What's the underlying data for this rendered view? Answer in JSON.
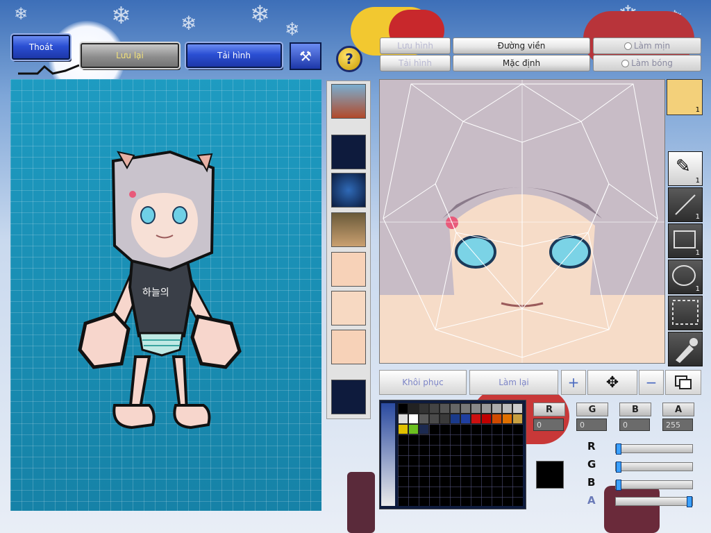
{
  "toolbar": {
    "exit_label": "Thoát",
    "save_label": "Lưu lại",
    "reload_label": "Tải hình",
    "help_label": "?"
  },
  "mode_tabs": {
    "save_image": "Lưu hình",
    "load_image": "Tải hình",
    "outline": "Đường viền",
    "default": "Mặc định",
    "smooth": "Làm mịn",
    "shade": "Làm bóng"
  },
  "character": {
    "shirt_text": "하늘의"
  },
  "tools": {
    "brush_count": "1",
    "line_count": "1",
    "rect_count": "1",
    "ellipse_count": "1",
    "portrait_count": "1"
  },
  "actions": {
    "restore_label": "Khôi phục",
    "redo_label": "Làm lại"
  },
  "color": {
    "r_label": "R",
    "g_label": "G",
    "b_label": "B",
    "a_label": "A",
    "r_value": "0",
    "g_value": "0",
    "b_value": "0",
    "a_value": "255",
    "current": "#000000",
    "r_fraction": 0.0,
    "g_fraction": 0.0,
    "b_fraction": 0.0,
    "a_fraction": 1.0,
    "swatches_row1": [
      "#000000",
      "#222222",
      "#333333",
      "#444444",
      "#555555",
      "#666666",
      "#777777",
      "#888888",
      "#999999",
      "#aaaaaa",
      "#bbbbbb",
      "#cccccc"
    ],
    "swatches_row2": [
      "#dddddd",
      "#ffffff",
      "#5a5a5a",
      "#4a4a4a",
      "#3a3a3a",
      "#1a3a8a",
      "#1f3fa0",
      "#cc1010",
      "#c00000",
      "#d04a00",
      "#e07000",
      "#c8a040"
    ],
    "swatches_row3": [
      "#e0c000",
      "#6cc020",
      "#1c2a50"
    ]
  }
}
